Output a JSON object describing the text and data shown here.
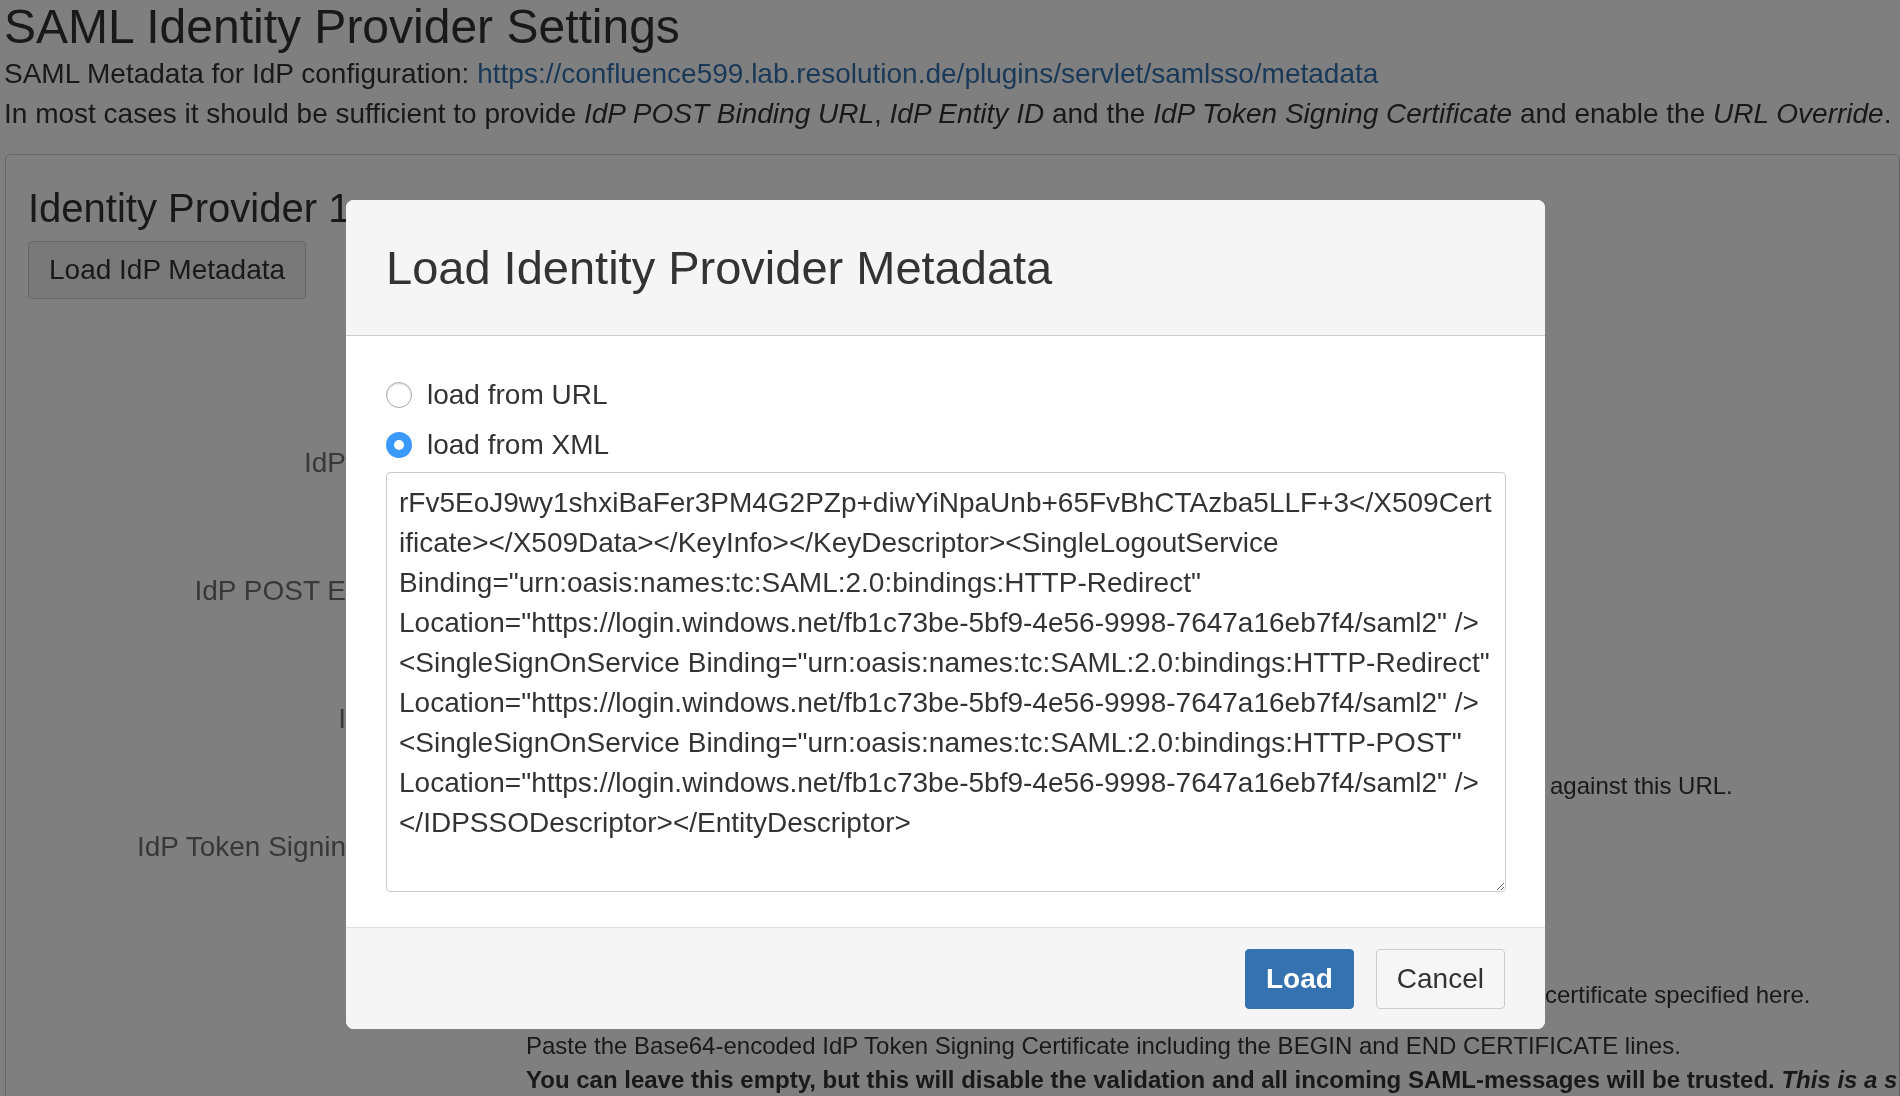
{
  "page": {
    "title": "SAML Identity Provider Settings",
    "metadata_label": "SAML Metadata for IdP configuration:",
    "metadata_link": "https://confluence599.lab.resolution.de/plugins/servlet/samlsso/metadata",
    "intro": "In most cases it should be sufficient to provide *IdP POST Binding URL*, *IdP Entity ID* and the *IdP Token Signing Certificate* and enable the *URL Override*."
  },
  "panel": {
    "title": "Identity Provider 1",
    "load_button": "Load IdP Metadata",
    "field_labels": [
      "IdP",
      "IdP POST E",
      "I",
      "IdP Token Signin"
    ],
    "help_texts": [
      {
        "text": "against this URL.",
        "kind": "plain"
      },
      {
        "text": "certificate specified here.",
        "kind": "plain"
      },
      {
        "text": "Paste the Base64-encoded IdP Token Signing Certificate including the BEGIN and END CERTIFICATE lines.",
        "kind": "plain"
      },
      {
        "text": "You can leave this empty, but this will disable the validation and all incoming SAML-messages will be trusted. *This is a s*",
        "kind": "warning"
      }
    ]
  },
  "dialog": {
    "title": "Load Identity Provider Metadata",
    "options": [
      {
        "label": "load from URL",
        "selected": false
      },
      {
        "label": "load from XML",
        "selected": true
      }
    ],
    "xml_value": "rFv5EoJ9wy1shxiBaFer3PM4G2PZp+diwYiNpaUnb+65FvBhCTAzba5LLF+3</X509Certificate></X509Data></KeyInfo></KeyDescriptor><SingleLogoutService Binding=\"urn:oasis:names:tc:SAML:2.0:bindings:HTTP-Redirect\" Location=\"https://login.windows.net/fb1c73be-5bf9-4e56-9998-7647a16eb7f4/saml2\" /><SingleSignOnService Binding=\"urn:oasis:names:tc:SAML:2.0:bindings:HTTP-Redirect\" Location=\"https://login.windows.net/fb1c73be-5bf9-4e56-9998-7647a16eb7f4/saml2\" /><SingleSignOnService Binding=\"urn:oasis:names:tc:SAML:2.0:bindings:HTTP-POST\" Location=\"https://login.windows.net/fb1c73be-5bf9-4e56-9998-7647a16eb7f4/saml2\" /></IDPSSODescriptor></EntityDescriptor>",
    "buttons": [
      {
        "label": "Load",
        "kind": "primary"
      },
      {
        "label": "Cancel",
        "kind": "secondary"
      }
    ]
  }
}
